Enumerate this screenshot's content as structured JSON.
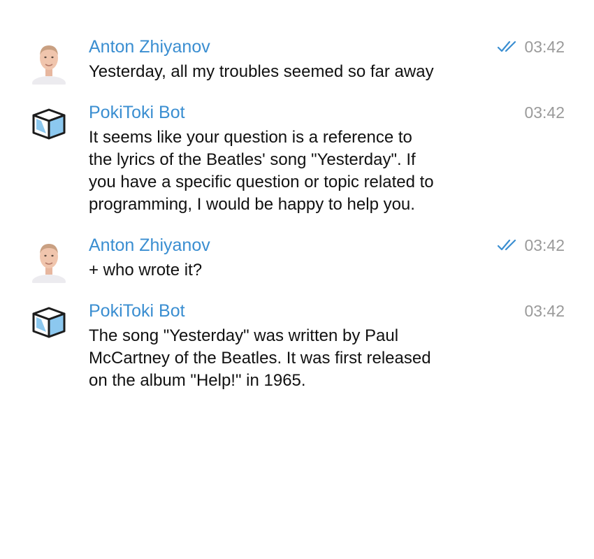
{
  "colors": {
    "sender_name": "#3a8ed1",
    "timestamp": "#9a9a9a",
    "read_check": "#3a8ed1",
    "text": "#111111"
  },
  "messages": [
    {
      "sender": "Anton Zhiyanov",
      "avatar": "user-avatar-photo",
      "time": "03:42",
      "status": "read-double-check-icon",
      "text": "Yesterday, all my troubles seemed so far away"
    },
    {
      "sender": "PokiToki Bot",
      "avatar": "bot-cube-avatar",
      "time": "03:42",
      "text": "It seems like your question is a reference to\nthe lyrics of the Beatles' song \"Yesterday\". If\nyou have a specific question or topic related to\nprogramming, I would be happy to help you."
    },
    {
      "sender": "Anton Zhiyanov",
      "avatar": "user-avatar-photo",
      "time": "03:42",
      "status": "read-double-check-icon",
      "text": "+ who wrote it?"
    },
    {
      "sender": "PokiToki Bot",
      "avatar": "bot-cube-avatar",
      "time": "03:42",
      "text": "The song \"Yesterday\" was written by Paul\nMcCartney of the Beatles. It was first released\non the album \"Help!\" in 1965."
    }
  ]
}
